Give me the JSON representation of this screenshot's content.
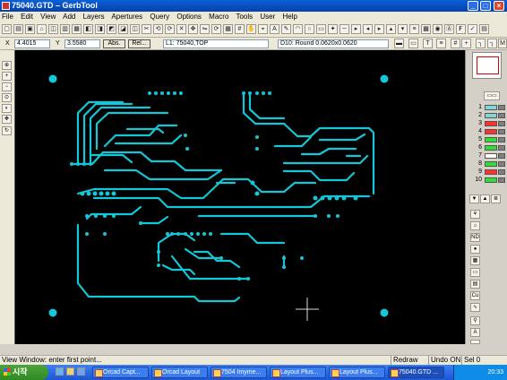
{
  "window": {
    "title": "75040.GTD – GerbTool"
  },
  "menu": [
    "File",
    "Edit",
    "View",
    "Add",
    "Layers",
    "Apertures",
    "Query",
    "Options",
    "Macro",
    "Tools",
    "User",
    "Help"
  ],
  "coords": {
    "x_label": "X",
    "x_value": "4.4015",
    "y_label": "Y",
    "y_value": "3.5580",
    "abs_label": "Abs.",
    "rel_label": "Rel...",
    "layer_select": "L1: 75040,TOP",
    "dcode_select": "D10: Round 0.0620x0.0620"
  },
  "layers": [
    {
      "num": "1",
      "color": "#7fd8d8"
    },
    {
      "num": "2",
      "color": "#7fd8d8"
    },
    {
      "num": "3",
      "color": "#ff3030"
    },
    {
      "num": "4",
      "color": "#ff3030"
    },
    {
      "num": "5",
      "color": "#30e030"
    },
    {
      "num": "6",
      "color": "#30e030"
    },
    {
      "num": "7",
      "color": "#ffffff"
    },
    {
      "num": "8",
      "color": "#30e030"
    },
    {
      "num": "9",
      "color": "#ff3030"
    },
    {
      "num": "10",
      "color": "#30e030"
    }
  ],
  "status": {
    "message": "View Window: enter first point...",
    "redraw": "Redraw ON",
    "undo": "Undo ON",
    "sel": "Sel 0"
  },
  "taskbar": {
    "start": "시작",
    "tasks": [
      "Orcad Capt...",
      "Orcad Layout",
      "7504 Imyme...",
      "Layout Plus...",
      "Layout Plus...",
      "75040.GTD ..."
    ],
    "clock": "20:33"
  },
  "colors": {
    "trace": "#12c8d8",
    "canvas": "#000000"
  }
}
